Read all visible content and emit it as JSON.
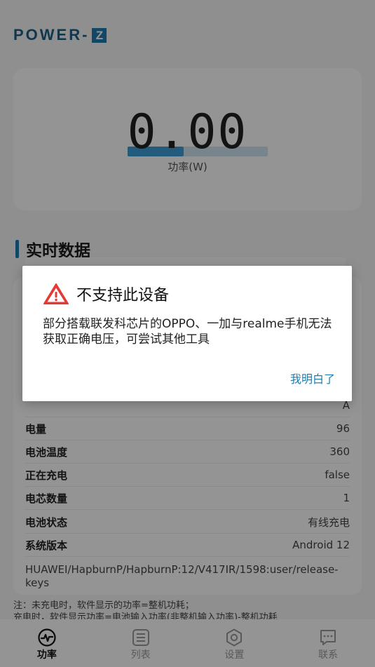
{
  "header": {
    "logo_text": "POWER-",
    "logo_z": "Z"
  },
  "power": {
    "value": "0.00",
    "unit": "功率(W)",
    "bar_fraction": 0.4
  },
  "section": {
    "title": "实时数据"
  },
  "data_rows": [
    {
      "label": "",
      "value": "A"
    },
    {
      "label": "电量",
      "value": "96"
    },
    {
      "label": "电池温度",
      "value": "360"
    },
    {
      "label": "正在充电",
      "value": "false"
    },
    {
      "label": "电芯数量",
      "value": "1"
    },
    {
      "label": "电池状态",
      "value": "有线充电"
    },
    {
      "label": "系统版本",
      "value": "Android 12"
    }
  ],
  "fingerprint": "HUAWEI/HapburnP/HapburnP:12/V417IR/1598:user/release-keys",
  "note": {
    "line1": "注：未充电时，软件显示的功率=整机功耗；",
    "line2": "充电时，软件显示功率=电池输入功率(非整机输入功率)-整机功耗"
  },
  "nav": [
    {
      "label": "功率",
      "icon": "pulse-icon",
      "active": true
    },
    {
      "label": "列表",
      "icon": "list-icon",
      "active": false
    },
    {
      "label": "设置",
      "icon": "settings-icon",
      "active": false
    },
    {
      "label": "联系",
      "icon": "chat-icon",
      "active": false
    }
  ],
  "dialog": {
    "title": "不支持此设备",
    "message": "部分搭载联发科芯片的OPPO、一加与realme手机无法获取正确电压，可尝试其他工具",
    "confirm": "我明白了"
  },
  "colors": {
    "accent": "#1f7dae",
    "warning": "#e53935"
  }
}
